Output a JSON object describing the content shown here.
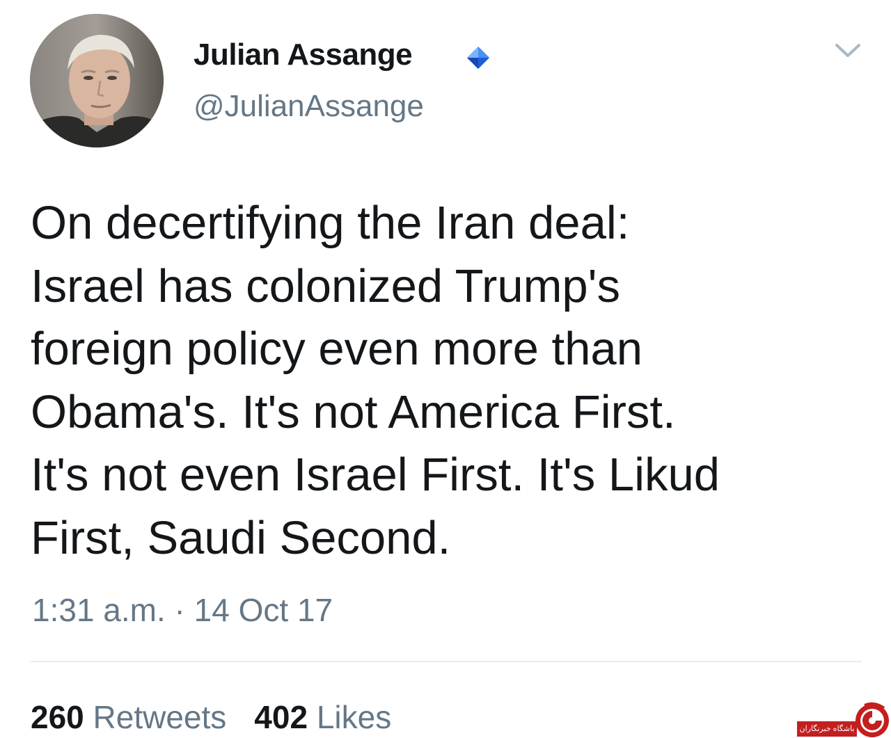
{
  "colors": {
    "text_primary": "#14171a",
    "text_secondary": "#657786",
    "verified_blue": "#1da1f2",
    "divider": "#e6ecf0",
    "watermark_red": "#c41e1e"
  },
  "author": {
    "display_name": "Julian Assange",
    "handle": "@JulianAssange",
    "verified_icon": "verified-badge-icon",
    "avatar": "profile-photo"
  },
  "menu": {
    "icon": "chevron-down-icon"
  },
  "tweet": {
    "lines": [
      "On decertifying the Iran deal:",
      "Israel has colonized Trump's",
      "foreign policy even more than",
      "Obama's. It's not America First.",
      "It's not even Israel First. It's Likud",
      "First, Saudi Second."
    ],
    "timestamp": "1:31 a.m. · 14 Oct 17"
  },
  "stats": {
    "retweets_count": "260",
    "retweets_label": "Retweets",
    "likes_count": "402",
    "likes_label": "Likes"
  },
  "watermark": {
    "text": "باشگاه خبرنگاران",
    "logo_icon": "news-agency-logo-icon"
  }
}
